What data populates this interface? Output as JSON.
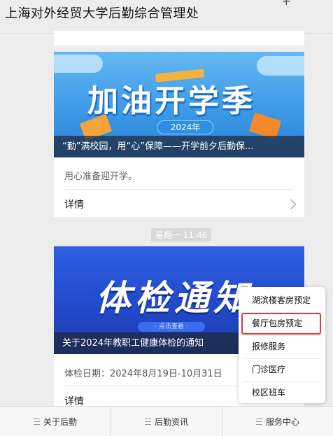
{
  "header": {
    "title": "上海对外经贸大学后勤综合管理处"
  },
  "articles": [
    {
      "banner_text": "加油开学季",
      "banner_year": "2024年",
      "caption": "“勤”满校园，用“心”保障——开学前夕后勤保...",
      "description": "用心准备迎开学。",
      "details_label": "详情"
    },
    {
      "banner_text": "体检通知",
      "banner_sub": "· 点击查看 ·",
      "caption": "关于2024年教职工健康体检的通知",
      "description": "体检日期：2024年8月19日-10月31日",
      "details_label": "详情"
    }
  ],
  "timestamp": "星期一 11:46",
  "bottom_nav": {
    "items": [
      {
        "label": "关于后勤"
      },
      {
        "label": "后勤资讯"
      },
      {
        "label": "服务中心"
      }
    ]
  },
  "popup_menu": {
    "items": [
      {
        "label": "湖滨楼客房预定"
      },
      {
        "label": "餐厅包房预定"
      },
      {
        "label": "报修服务"
      },
      {
        "label": "门诊医疗"
      },
      {
        "label": "校区班车"
      }
    ],
    "highlighted_index": 1,
    "highlight_color": "#e53935"
  },
  "colors": {
    "page_bg": "#ededed",
    "banner1_blue": "#3c9ae7",
    "banner2_blue": "#2148c9"
  },
  "icons": {
    "corner": "plus-icon",
    "nav": "menu-icon",
    "chevron": "chevron-right-icon"
  }
}
